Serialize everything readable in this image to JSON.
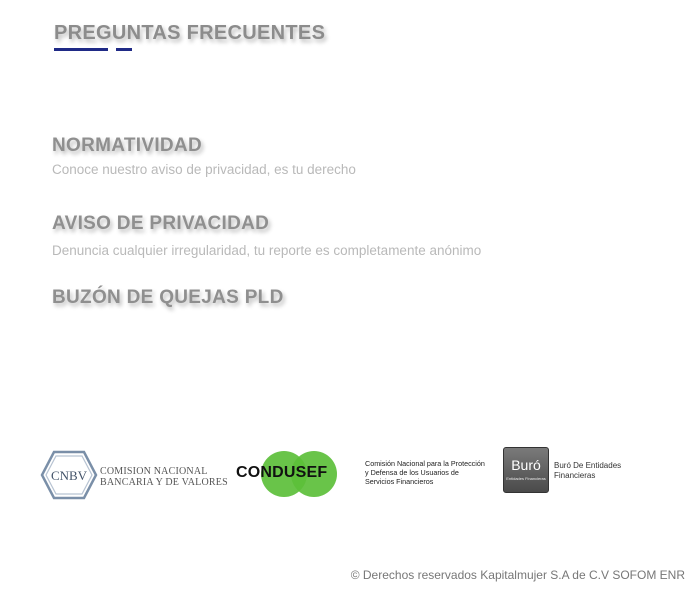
{
  "faq": {
    "title": "PREGUNTAS FRECUENTES"
  },
  "sections": [
    {
      "heading": "NORMATIVIDAD",
      "description": "Conoce nuestro aviso de privacidad, es tu derecho"
    },
    {
      "heading": "AVISO DE PRIVACIDAD",
      "description": "Denuncia cualquier irregularidad, tu reporte es completamente anónimo"
    },
    {
      "heading": "BUZÓN DE QUEJAS PLD",
      "description": ""
    }
  ],
  "logos": {
    "cnbv": {
      "mark": "CNBV",
      "name_line1": "COMISION NACIONAL",
      "name_line2": "BANCARIA Y DE VALORES"
    },
    "condusef": {
      "mark": "CONDUSEF",
      "line1": "Comisión Nacional para la Protección",
      "line2": "y Defensa de los Usuarios de",
      "line3": "Servicios Financieros"
    },
    "buro": {
      "mark": "Buró",
      "mark_sub": "Entidades Financieras",
      "line1": "Buró De Entidades",
      "line2": "Financieras"
    }
  },
  "footer": {
    "copyright": "© Derechos reservados Kapitalmujer S.A de C.V SOFOM ENR"
  },
  "colors": {
    "accent": "#1f2a86",
    "heading": "#8f8f8f",
    "description": "#b9b9b9",
    "condusef_green": "#5cbf3a"
  }
}
